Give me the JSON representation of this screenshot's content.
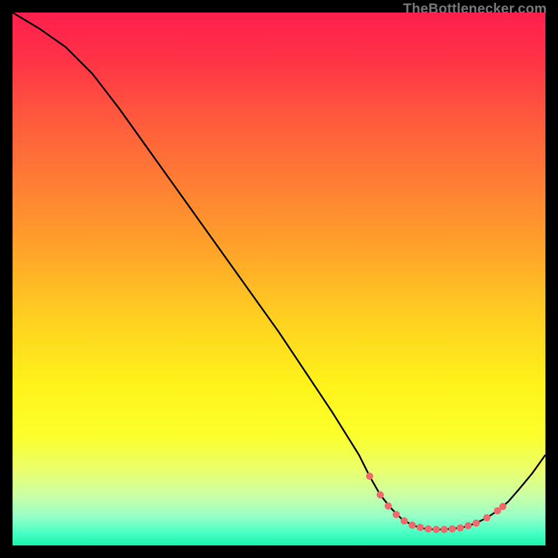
{
  "watermark": {
    "text": "TheBottlenecker.com"
  },
  "chart_data": {
    "type": "line",
    "title": "",
    "xlabel": "",
    "ylabel": "",
    "xlim": [
      0,
      100
    ],
    "ylim": [
      0,
      100
    ],
    "curve": {
      "name": "bottleneck-curve",
      "color": "#000000",
      "points": [
        {
          "x": 0.0,
          "y": 100.0
        },
        {
          "x": 5.0,
          "y": 97.0
        },
        {
          "x": 10.0,
          "y": 93.5
        },
        {
          "x": 15.0,
          "y": 88.5
        },
        {
          "x": 20.0,
          "y": 82.0
        },
        {
          "x": 25.0,
          "y": 75.0
        },
        {
          "x": 30.0,
          "y": 68.0
        },
        {
          "x": 35.0,
          "y": 61.0
        },
        {
          "x": 40.0,
          "y": 54.0
        },
        {
          "x": 45.0,
          "y": 47.0
        },
        {
          "x": 50.0,
          "y": 40.0
        },
        {
          "x": 55.0,
          "y": 32.5
        },
        {
          "x": 60.0,
          "y": 25.0
        },
        {
          "x": 65.0,
          "y": 17.0
        },
        {
          "x": 67.0,
          "y": 13.0
        },
        {
          "x": 69.0,
          "y": 9.5
        },
        {
          "x": 71.0,
          "y": 7.0
        },
        {
          "x": 73.0,
          "y": 5.0
        },
        {
          "x": 75.0,
          "y": 3.8
        },
        {
          "x": 77.0,
          "y": 3.2
        },
        {
          "x": 79.0,
          "y": 3.0
        },
        {
          "x": 81.0,
          "y": 3.0
        },
        {
          "x": 83.0,
          "y": 3.2
        },
        {
          "x": 85.0,
          "y": 3.5
        },
        {
          "x": 87.0,
          "y": 4.2
        },
        {
          "x": 89.0,
          "y": 5.2
        },
        {
          "x": 91.0,
          "y": 6.5
        },
        {
          "x": 93.0,
          "y": 8.2
        },
        {
          "x": 95.0,
          "y": 10.5
        },
        {
          "x": 97.5,
          "y": 13.5
        },
        {
          "x": 100.0,
          "y": 17.0
        }
      ]
    },
    "markers": {
      "name": "highlighted-points",
      "color": "#ed6a6d",
      "radius": 5.2,
      "points": [
        {
          "x": 67.0,
          "y": 13.0
        },
        {
          "x": 69.0,
          "y": 9.5
        },
        {
          "x": 70.5,
          "y": 7.4
        },
        {
          "x": 72.0,
          "y": 5.8
        },
        {
          "x": 73.5,
          "y": 4.6
        },
        {
          "x": 75.0,
          "y": 3.8
        },
        {
          "x": 76.5,
          "y": 3.4
        },
        {
          "x": 78.0,
          "y": 3.1
        },
        {
          "x": 79.5,
          "y": 3.0
        },
        {
          "x": 81.0,
          "y": 3.0
        },
        {
          "x": 82.5,
          "y": 3.1
        },
        {
          "x": 84.0,
          "y": 3.3
        },
        {
          "x": 85.5,
          "y": 3.7
        },
        {
          "x": 87.0,
          "y": 4.2
        },
        {
          "x": 89.0,
          "y": 5.2
        },
        {
          "x": 91.0,
          "y": 6.5
        },
        {
          "x": 92.0,
          "y": 7.3
        }
      ]
    },
    "background": {
      "gradient_stops": [
        {
          "offset": 0.0,
          "color": "#ff1f4d"
        },
        {
          "offset": 0.09,
          "color": "#ff3346"
        },
        {
          "offset": 0.2,
          "color": "#ff5a3d"
        },
        {
          "offset": 0.32,
          "color": "#ff7e34"
        },
        {
          "offset": 0.45,
          "color": "#ffa529"
        },
        {
          "offset": 0.58,
          "color": "#ffd220"
        },
        {
          "offset": 0.7,
          "color": "#fff31a"
        },
        {
          "offset": 0.795,
          "color": "#fbff2c"
        },
        {
          "offset": 0.855,
          "color": "#ecff68"
        },
        {
          "offset": 0.905,
          "color": "#ccffa4"
        },
        {
          "offset": 0.945,
          "color": "#98ffc6"
        },
        {
          "offset": 0.975,
          "color": "#4dffc6"
        },
        {
          "offset": 1.0,
          "color": "#17f5ad"
        }
      ]
    }
  }
}
